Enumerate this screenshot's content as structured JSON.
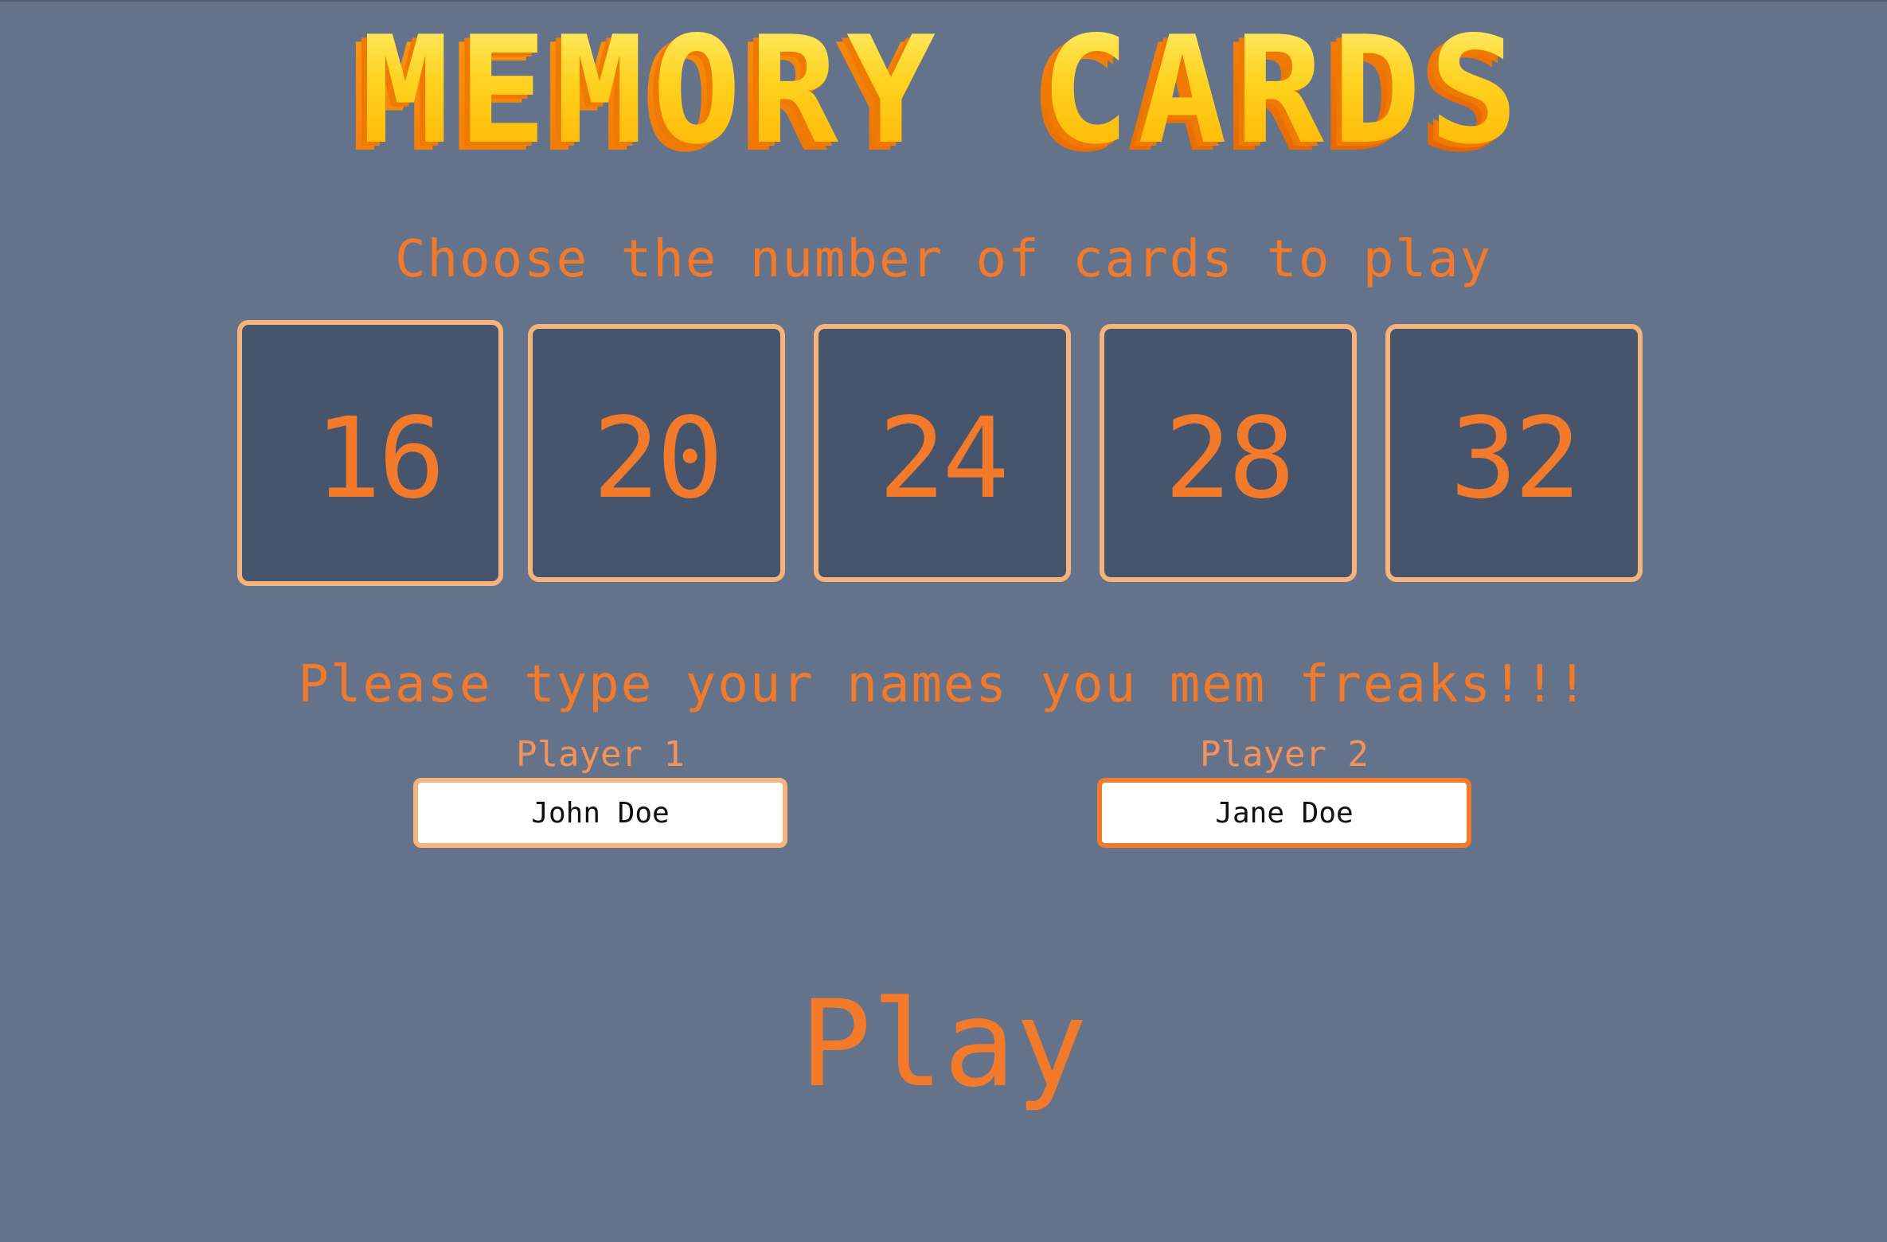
{
  "logo": {
    "text": "MEMORY CARDS",
    "colors": {
      "face": "#ffd21f",
      "side": "#ff8a00",
      "dark": "#e36a00"
    }
  },
  "cards_prompt": "Choose the number of cards to play",
  "card_options": [
    "16",
    "20",
    "24",
    "28",
    "32"
  ],
  "selected_option": "16",
  "names_prompt": "Please type your names you mem freaks!!!",
  "players": [
    {
      "label": "Player 1",
      "value": "John Doe"
    },
    {
      "label": "Player 2",
      "value": "Jane Doe"
    }
  ],
  "play_label": "Play",
  "colors": {
    "background": "#65738a",
    "accent": "#f27a2a",
    "card_fill": "#46556b",
    "card_border": "#f6b47a"
  }
}
